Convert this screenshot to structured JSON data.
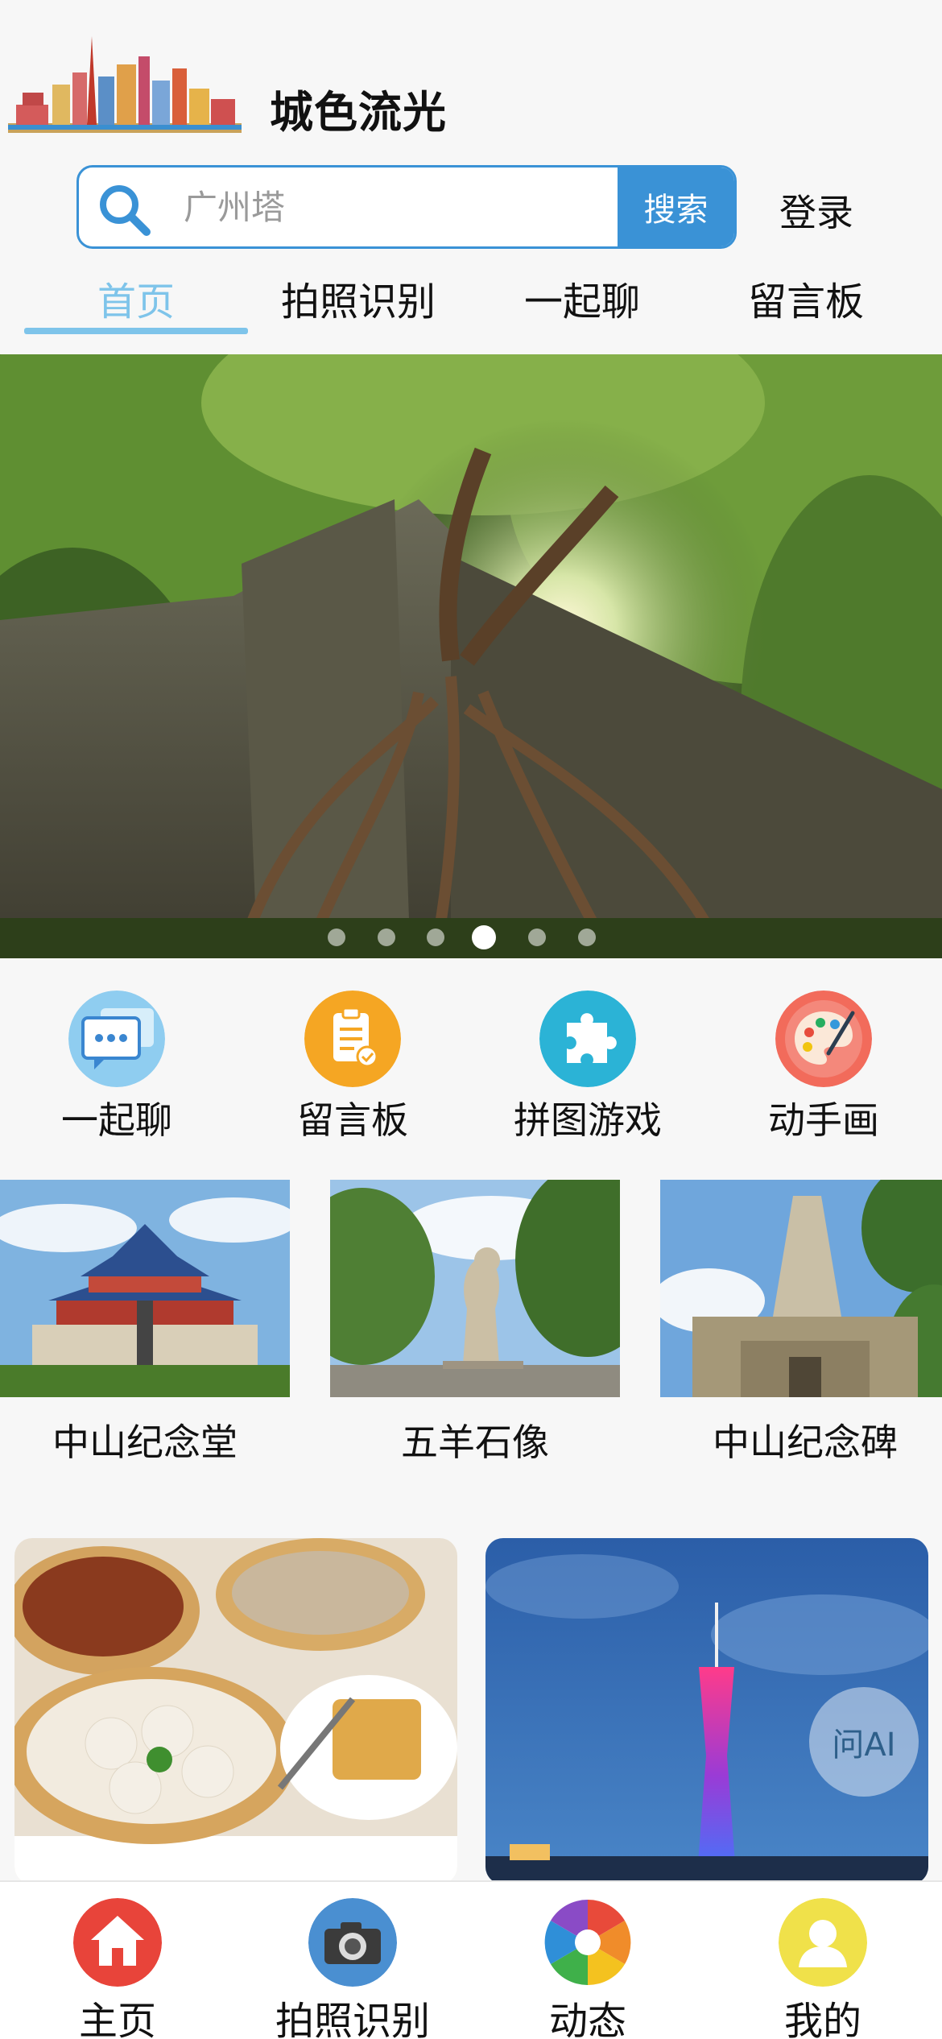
{
  "app": {
    "title": "城色流光"
  },
  "search": {
    "placeholder": "广州塔",
    "button_label": "搜索",
    "login_label": "登录"
  },
  "tabs": [
    {
      "label": "首页",
      "active": true
    },
    {
      "label": "拍照识别"
    },
    {
      "label": "一起聊"
    },
    {
      "label": "留言板"
    }
  ],
  "banner": {
    "slide_count": 6,
    "active_index": 3
  },
  "quick_actions": [
    {
      "label": "一起聊",
      "icon": "chat-bubble-icon",
      "color": "#8fcdf0"
    },
    {
      "label": "留言板",
      "icon": "clipboard-icon",
      "color": "#f5a623"
    },
    {
      "label": "拼图游戏",
      "icon": "puzzle-icon",
      "color": "#2bb3d6"
    },
    {
      "label": "动手画",
      "icon": "palette-icon",
      "color": "#f26b5b"
    }
  ],
  "attractions": [
    {
      "label": "中山纪念堂"
    },
    {
      "label": "五羊石像"
    },
    {
      "label": "中山纪念碑"
    }
  ],
  "ai_button": {
    "label": "问AI"
  },
  "bottom_nav": [
    {
      "label": "主页",
      "icon": "home-icon",
      "color": "#e8443a"
    },
    {
      "label": "拍照识别",
      "icon": "camera-icon",
      "color": "#4a8fd1"
    },
    {
      "label": "动态",
      "icon": "aperture-icon",
      "color": "#f0b400"
    },
    {
      "label": "我的",
      "icon": "user-icon",
      "color": "#f0e14a"
    }
  ]
}
